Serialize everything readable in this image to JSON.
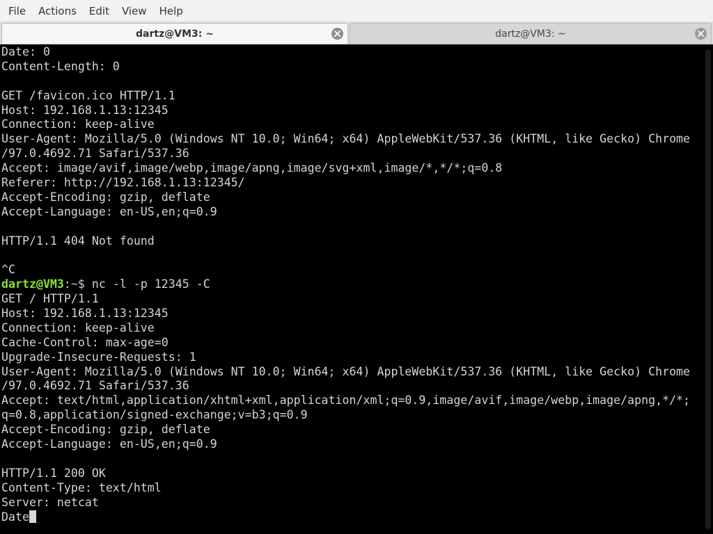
{
  "menu": {
    "items": [
      "File",
      "Actions",
      "Edit",
      "View",
      "Help"
    ]
  },
  "tabs": [
    {
      "label": "dartz@VM3: ~",
      "active": true
    },
    {
      "label": "dartz@VM3: ~",
      "active": false
    }
  ],
  "terminal": {
    "colors": {
      "background": "#000000",
      "foreground": "#d3d7cf",
      "prompt_user": "#8ae234",
      "prompt_path": "#729fcf"
    },
    "lines_before_prompt": [
      "Date: 0",
      "Content-Length: 0",
      "",
      "GET /favicon.ico HTTP/1.1",
      "Host: 192.168.1.13:12345",
      "Connection: keep-alive",
      "User-Agent: Mozilla/5.0 (Windows NT 10.0; Win64; x64) AppleWebKit/537.36 (KHTML, like Gecko) Chrome",
      "/97.0.4692.71 Safari/537.36",
      "Accept: image/avif,image/webp,image/apng,image/svg+xml,image/*,*/*;q=0.8",
      "Referer: http://192.168.1.13:12345/",
      "Accept-Encoding: gzip, deflate",
      "Accept-Language: en-US,en;q=0.9",
      "",
      "HTTP/1.1 404 Not found",
      "",
      "^C"
    ],
    "prompt": {
      "user_host": "dartz@VM3",
      "separator": ":",
      "path": "~",
      "symbol": "$ ",
      "command": "nc -l -p 12345 -C"
    },
    "lines_after_prompt": [
      "GET / HTTP/1.1",
      "Host: 192.168.1.13:12345",
      "Connection: keep-alive",
      "Cache-Control: max-age=0",
      "Upgrade-Insecure-Requests: 1",
      "User-Agent: Mozilla/5.0 (Windows NT 10.0; Win64; x64) AppleWebKit/537.36 (KHTML, like Gecko) Chrome",
      "/97.0.4692.71 Safari/537.36",
      "Accept: text/html,application/xhtml+xml,application/xml;q=0.9,image/avif,image/webp,image/apng,*/*;",
      "q=0.8,application/signed-exchange;v=b3;q=0.9",
      "Accept-Encoding: gzip, deflate",
      "Accept-Language: en-US,en;q=0.9",
      "",
      "HTTP/1.1 200 OK",
      "Content-Type: text/html",
      "Server: netcat"
    ],
    "current_input": "Date"
  }
}
